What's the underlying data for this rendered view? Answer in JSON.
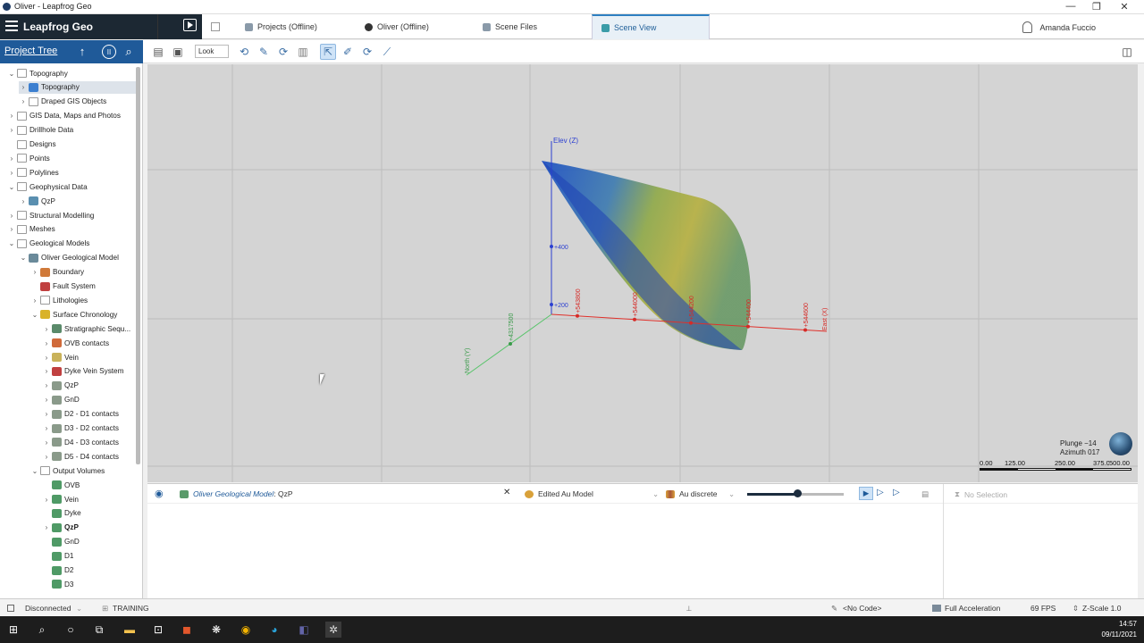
{
  "window": {
    "title": "Oliver - Leapfrog Geo",
    "minimize": "—",
    "restore": "❐",
    "close": "✕"
  },
  "brand": {
    "name": "Leapfrog Geo"
  },
  "tabs": [
    {
      "label": "Projects (Offline)",
      "icon": "projects-icon"
    },
    {
      "label": "Oliver (Offline)",
      "icon": "project-icon"
    },
    {
      "label": "Scene Files",
      "icon": "scene-files-icon"
    },
    {
      "label": "Scene View",
      "icon": "scene-view-icon",
      "active": true
    }
  ],
  "user": {
    "name": "Amanda Fuccio"
  },
  "project_tree": {
    "header": "Project Tree",
    "nodes": [
      {
        "label": "Topography",
        "depth": 0,
        "toggle": "⌄",
        "icon": "folder"
      },
      {
        "label": "Topography",
        "depth": 1,
        "toggle": "›",
        "icon": "surface",
        "selected": true
      },
      {
        "label": "Draped GIS Objects",
        "depth": 1,
        "toggle": "›",
        "icon": "folder"
      },
      {
        "label": "GIS Data, Maps and Photos",
        "depth": 0,
        "toggle": "›",
        "icon": "folder"
      },
      {
        "label": "Drillhole Data",
        "depth": 0,
        "toggle": "›",
        "icon": "folder"
      },
      {
        "label": "Designs",
        "depth": 0,
        "toggle": "",
        "icon": "folder"
      },
      {
        "label": "Points",
        "depth": 0,
        "toggle": "›",
        "icon": "folder"
      },
      {
        "label": "Polylines",
        "depth": 0,
        "toggle": "›",
        "icon": "folder"
      },
      {
        "label": "Geophysical Data",
        "depth": 0,
        "toggle": "⌄",
        "icon": "folder"
      },
      {
        "label": "QzP",
        "depth": 1,
        "toggle": "›",
        "icon": "grid"
      },
      {
        "label": "Structural Modelling",
        "depth": 0,
        "toggle": "›",
        "icon": "folder"
      },
      {
        "label": "Meshes",
        "depth": 0,
        "toggle": "›",
        "icon": "folder"
      },
      {
        "label": "Geological Models",
        "depth": 0,
        "toggle": "⌄",
        "icon": "folder"
      },
      {
        "label": "Oliver Geological Model",
        "depth": 1,
        "toggle": "⌄",
        "icon": "model"
      },
      {
        "label": "Boundary",
        "depth": 2,
        "toggle": "›",
        "icon": "boundary"
      },
      {
        "label": "Fault System",
        "depth": 2,
        "toggle": "",
        "icon": "fault"
      },
      {
        "label": "Lithologies",
        "depth": 2,
        "toggle": "›",
        "icon": "folder"
      },
      {
        "label": "Surface Chronology",
        "depth": 2,
        "toggle": "⌄",
        "icon": "chron"
      },
      {
        "label": "Stratigraphic Sequ...",
        "depth": 3,
        "toggle": "›",
        "icon": "strat"
      },
      {
        "label": "OVB contacts",
        "depth": 3,
        "toggle": "›",
        "icon": "ovb"
      },
      {
        "label": "Vein",
        "depth": 3,
        "toggle": "›",
        "icon": "vein"
      },
      {
        "label": "Dyke Vein System",
        "depth": 3,
        "toggle": "›",
        "icon": "dyke"
      },
      {
        "label": "QzP",
        "depth": 3,
        "toggle": "›",
        "icon": "contact"
      },
      {
        "label": "GnD",
        "depth": 3,
        "toggle": "›",
        "icon": "contact"
      },
      {
        "label": "D2 - D1 contacts",
        "depth": 3,
        "toggle": "›",
        "icon": "contact"
      },
      {
        "label": "D3 - D2 contacts",
        "depth": 3,
        "toggle": "›",
        "icon": "contact"
      },
      {
        "label": "D4 - D3 contacts",
        "depth": 3,
        "toggle": "›",
        "icon": "contact"
      },
      {
        "label": "D5 - D4 contacts",
        "depth": 3,
        "toggle": "›",
        "icon": "contact"
      },
      {
        "label": "Output Volumes",
        "depth": 2,
        "toggle": "⌄",
        "icon": "folder"
      },
      {
        "label": "OVB",
        "depth": 3,
        "toggle": "",
        "icon": "volume"
      },
      {
        "label": "Vein",
        "depth": 3,
        "toggle": "›",
        "icon": "volume"
      },
      {
        "label": "Dyke",
        "depth": 3,
        "toggle": "",
        "icon": "volume"
      },
      {
        "label": "QzP",
        "depth": 3,
        "toggle": "›",
        "icon": "volume",
        "bold": true
      },
      {
        "label": "GnD",
        "depth": 3,
        "toggle": "",
        "icon": "volume"
      },
      {
        "label": "D1",
        "depth": 3,
        "toggle": "",
        "icon": "volume"
      },
      {
        "label": "D2",
        "depth": 3,
        "toggle": "",
        "icon": "volume"
      },
      {
        "label": "D3",
        "depth": 3,
        "toggle": "",
        "icon": "volume"
      }
    ]
  },
  "toolbar": {
    "look_label": "Look"
  },
  "scene": {
    "elev_label": "Elev (Z)",
    "north_label": "North (Y)",
    "east_label": "East (X)",
    "elev_ticks": [
      "+400",
      "+200"
    ],
    "east_ticks": [
      "+543800",
      "+544000",
      "+544200",
      "+544400",
      "+544600"
    ],
    "north_ticks": [
      "+4317500"
    ],
    "plunge": "Plunge −14",
    "azimuth": "Azimuth 017",
    "scale_labels": [
      "0.00",
      "125.00",
      "250.00",
      "375.00",
      "500.00"
    ]
  },
  "bottom": {
    "object_prefix": "Oliver Geological Model",
    "object_suffix": ": QzP",
    "evaluation": "Edited Au Model",
    "colormap": "Au discrete",
    "slider_fraction": 0.52,
    "selection": "No Selection"
  },
  "status": {
    "connection": "Disconnected",
    "mode": "TRAINING",
    "code": "<No Code>",
    "acceleration": "Full Acceleration",
    "fps": "69 FPS",
    "zscale": "Z-Scale 1.0"
  },
  "taskbar": {
    "time": "14:57",
    "date": "09/11/2021"
  },
  "colors": {
    "brand_bg": "#1c2833",
    "tree_header": "#1f5a99",
    "accent": "#2d7fc1"
  }
}
